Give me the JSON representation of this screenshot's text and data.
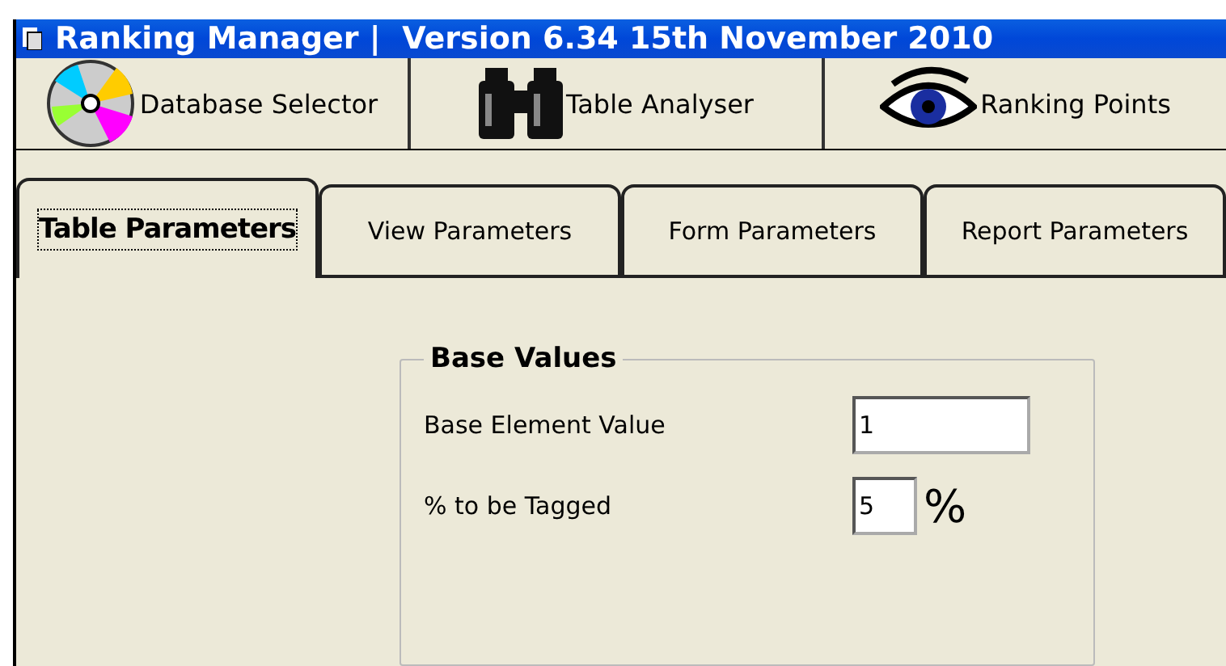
{
  "window": {
    "title": "Ranking Manager |  Version 6.34 15th November 2010"
  },
  "toolbar": [
    {
      "label": "Database Selector",
      "kind": "disc"
    },
    {
      "label": "Table Analyser",
      "kind": "binoculars"
    },
    {
      "label": "Ranking Points",
      "kind": "eye"
    }
  ],
  "tabs": [
    {
      "label": "Table Parameters",
      "selected": true
    },
    {
      "label": "View Parameters",
      "selected": false
    },
    {
      "label": "Form Parameters",
      "selected": false
    },
    {
      "label": "Report Parameters",
      "selected": false
    }
  ],
  "group": {
    "title": "Base Values",
    "fields": [
      {
        "label": "Base Element Value",
        "value": "1",
        "kind": "wide"
      },
      {
        "label": "% to be Tagged",
        "value": "5",
        "kind": "percent",
        "unit": "%"
      }
    ]
  }
}
